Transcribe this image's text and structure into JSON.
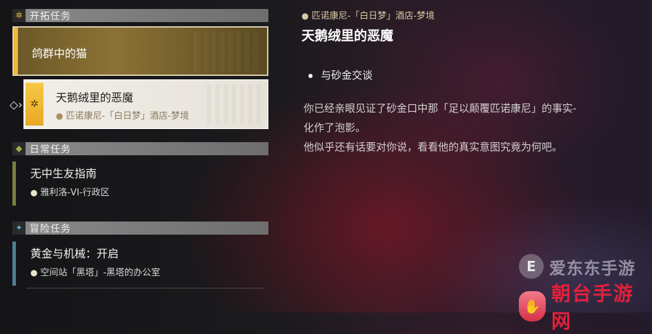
{
  "categories": {
    "trailblaze": {
      "label": "开拓任务",
      "icon": "trailblaze-icon",
      "color": "#f0b93a"
    },
    "daily": {
      "label": "日常任务",
      "icon": "daily-icon",
      "color": "#9ab34a"
    },
    "adventure": {
      "label": "冒险任务",
      "icon": "adventure-icon",
      "color": "#5fb0cf"
    }
  },
  "missions": {
    "pigeon": {
      "title": "鸽群中的猫"
    },
    "swan": {
      "title": "天鹅绒里的恶魔",
      "location": "匹诺康尼-「白日梦」酒店-梦境"
    },
    "friend": {
      "title": "无中生友指南",
      "location": "雅利洛-VI-行政区",
      "bar_color": "#7c7f3e"
    },
    "gold": {
      "title": "黄金与机械：开启",
      "location": "空间站「黑塔」-黑塔的办公室",
      "bar_color": "#4f7f95"
    }
  },
  "detail": {
    "location": "匹诺康尼-「白日梦」酒店-梦境",
    "title": "天鹅绒里的恶魔",
    "objective": "与砂金交谈",
    "description_line1": "你已经亲眼见证了砂金口中那「足以颠覆匹诺康尼」的事实-",
    "description_line2": "化作了泡影。",
    "description_line3": "他似乎还有话要对你说，看看他的真实意图究竟为何吧。"
  },
  "watermarks": {
    "site1": "爱东东手游",
    "site1_logo": "E",
    "site2": "朝台手游网"
  }
}
